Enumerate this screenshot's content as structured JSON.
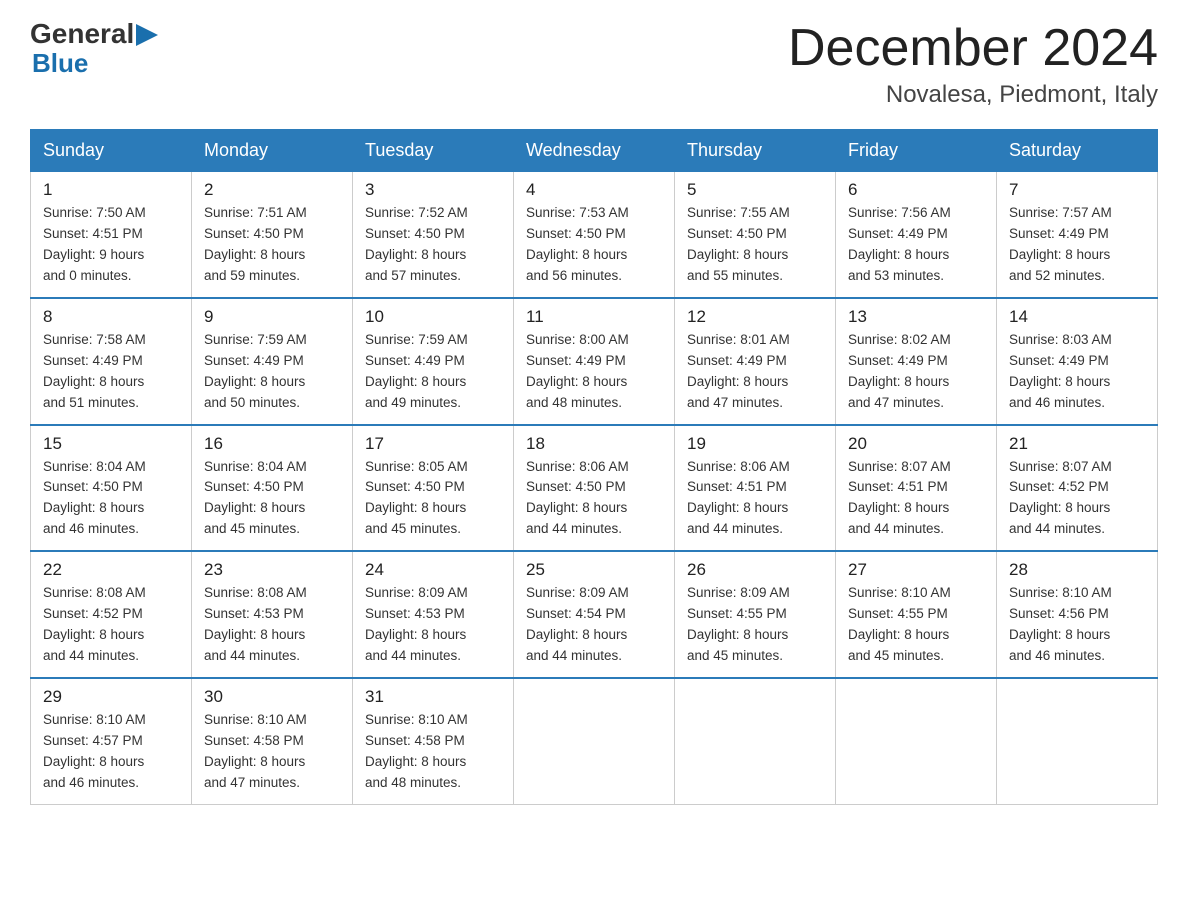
{
  "logo": {
    "general": "General",
    "arrow": "▶",
    "blue": "Blue"
  },
  "header": {
    "month": "December 2024",
    "location": "Novalesa, Piedmont, Italy"
  },
  "days": [
    "Sunday",
    "Monday",
    "Tuesday",
    "Wednesday",
    "Thursday",
    "Friday",
    "Saturday"
  ],
  "weeks": [
    [
      {
        "num": "1",
        "sunrise": "7:50 AM",
        "sunset": "4:51 PM",
        "daylight": "9 hours and 0 minutes."
      },
      {
        "num": "2",
        "sunrise": "7:51 AM",
        "sunset": "4:50 PM",
        "daylight": "8 hours and 59 minutes."
      },
      {
        "num": "3",
        "sunrise": "7:52 AM",
        "sunset": "4:50 PM",
        "daylight": "8 hours and 57 minutes."
      },
      {
        "num": "4",
        "sunrise": "7:53 AM",
        "sunset": "4:50 PM",
        "daylight": "8 hours and 56 minutes."
      },
      {
        "num": "5",
        "sunrise": "7:55 AM",
        "sunset": "4:50 PM",
        "daylight": "8 hours and 55 minutes."
      },
      {
        "num": "6",
        "sunrise": "7:56 AM",
        "sunset": "4:49 PM",
        "daylight": "8 hours and 53 minutes."
      },
      {
        "num": "7",
        "sunrise": "7:57 AM",
        "sunset": "4:49 PM",
        "daylight": "8 hours and 52 minutes."
      }
    ],
    [
      {
        "num": "8",
        "sunrise": "7:58 AM",
        "sunset": "4:49 PM",
        "daylight": "8 hours and 51 minutes."
      },
      {
        "num": "9",
        "sunrise": "7:59 AM",
        "sunset": "4:49 PM",
        "daylight": "8 hours and 50 minutes."
      },
      {
        "num": "10",
        "sunrise": "7:59 AM",
        "sunset": "4:49 PM",
        "daylight": "8 hours and 49 minutes."
      },
      {
        "num": "11",
        "sunrise": "8:00 AM",
        "sunset": "4:49 PM",
        "daylight": "8 hours and 48 minutes."
      },
      {
        "num": "12",
        "sunrise": "8:01 AM",
        "sunset": "4:49 PM",
        "daylight": "8 hours and 47 minutes."
      },
      {
        "num": "13",
        "sunrise": "8:02 AM",
        "sunset": "4:49 PM",
        "daylight": "8 hours and 47 minutes."
      },
      {
        "num": "14",
        "sunrise": "8:03 AM",
        "sunset": "4:49 PM",
        "daylight": "8 hours and 46 minutes."
      }
    ],
    [
      {
        "num": "15",
        "sunrise": "8:04 AM",
        "sunset": "4:50 PM",
        "daylight": "8 hours and 46 minutes."
      },
      {
        "num": "16",
        "sunrise": "8:04 AM",
        "sunset": "4:50 PM",
        "daylight": "8 hours and 45 minutes."
      },
      {
        "num": "17",
        "sunrise": "8:05 AM",
        "sunset": "4:50 PM",
        "daylight": "8 hours and 45 minutes."
      },
      {
        "num": "18",
        "sunrise": "8:06 AM",
        "sunset": "4:50 PM",
        "daylight": "8 hours and 44 minutes."
      },
      {
        "num": "19",
        "sunrise": "8:06 AM",
        "sunset": "4:51 PM",
        "daylight": "8 hours and 44 minutes."
      },
      {
        "num": "20",
        "sunrise": "8:07 AM",
        "sunset": "4:51 PM",
        "daylight": "8 hours and 44 minutes."
      },
      {
        "num": "21",
        "sunrise": "8:07 AM",
        "sunset": "4:52 PM",
        "daylight": "8 hours and 44 minutes."
      }
    ],
    [
      {
        "num": "22",
        "sunrise": "8:08 AM",
        "sunset": "4:52 PM",
        "daylight": "8 hours and 44 minutes."
      },
      {
        "num": "23",
        "sunrise": "8:08 AM",
        "sunset": "4:53 PM",
        "daylight": "8 hours and 44 minutes."
      },
      {
        "num": "24",
        "sunrise": "8:09 AM",
        "sunset": "4:53 PM",
        "daylight": "8 hours and 44 minutes."
      },
      {
        "num": "25",
        "sunrise": "8:09 AM",
        "sunset": "4:54 PM",
        "daylight": "8 hours and 44 minutes."
      },
      {
        "num": "26",
        "sunrise": "8:09 AM",
        "sunset": "4:55 PM",
        "daylight": "8 hours and 45 minutes."
      },
      {
        "num": "27",
        "sunrise": "8:10 AM",
        "sunset": "4:55 PM",
        "daylight": "8 hours and 45 minutes."
      },
      {
        "num": "28",
        "sunrise": "8:10 AM",
        "sunset": "4:56 PM",
        "daylight": "8 hours and 46 minutes."
      }
    ],
    [
      {
        "num": "29",
        "sunrise": "8:10 AM",
        "sunset": "4:57 PM",
        "daylight": "8 hours and 46 minutes."
      },
      {
        "num": "30",
        "sunrise": "8:10 AM",
        "sunset": "4:58 PM",
        "daylight": "8 hours and 47 minutes."
      },
      {
        "num": "31",
        "sunrise": "8:10 AM",
        "sunset": "4:58 PM",
        "daylight": "8 hours and 48 minutes."
      },
      null,
      null,
      null,
      null
    ]
  ]
}
